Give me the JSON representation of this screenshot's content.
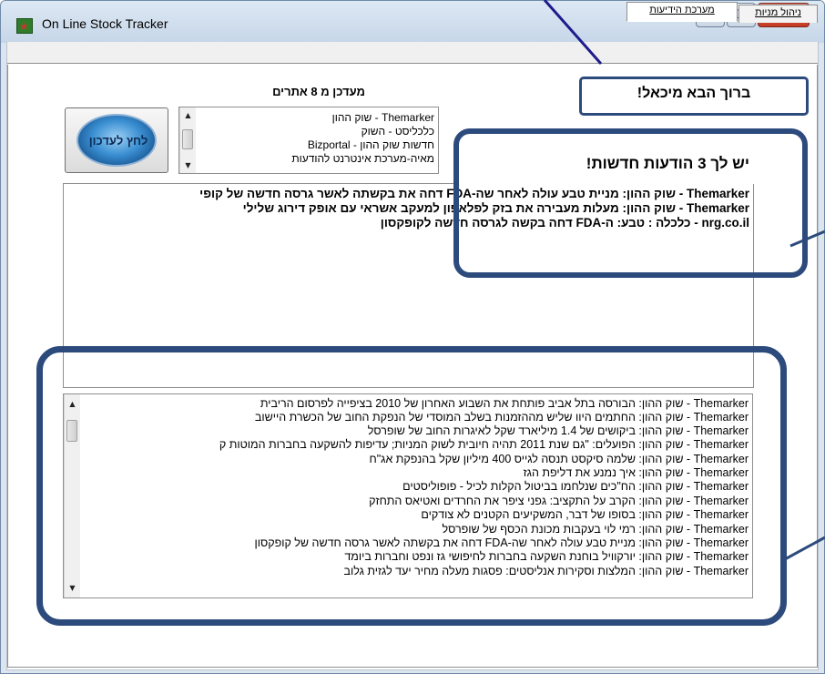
{
  "window": {
    "title": "On Line Stock Tracker",
    "controls": {
      "minimize": "—",
      "maximize": "☐",
      "close": "✕"
    }
  },
  "tabs": [
    {
      "label": "ניהול מניות",
      "selected": false
    },
    {
      "label": "מערכת הידיעות",
      "selected": true
    }
  ],
  "welcome_banner": "ברוך הבא מיכאל!",
  "new_messages_banner": "יש לך 3 הודעות חדשות!",
  "updated_title": "מעדכן מ 8 אתרים",
  "refresh_button": {
    "label": "לחץ לעדכון",
    "icon": "refresh-globe-icon"
  },
  "sources": [
    "Themarker - שוק ההון",
    "כלכליסט - השוק",
    "חדשות שוק ההון - Bizportal",
    "מאיה-מערכת אינטרנט להודעות"
  ],
  "alerts": [
    "Themarker - שוק ההון: מניית טבע עולה לאחר שה-FDA דחה את בקשתה לאשר גרסה חדשה של קופי",
    "Themarker - שוק ההון: מעלות מעבירה את בזק לפלאפון למעקב אשראי עם אופק דירוג שלילי",
    "nrg.co.il - כלכלה : טבע: ה-FDA דחה בקשה לגרסה חדשה לקופקסון"
  ],
  "headlines": [
    "Themarker - שוק ההון: הבורסה בתל אביב פותחת את השבוע האחרון של 2010 בציפייה לפרסום הריבית",
    "Themarker - שוק ההון: החתמים היוו שליש מההזמנות בשלב המוסדי של הנפקת החוב של הכשרת היישוב",
    "Themarker - שוק ההון: ביקושים של 1.4 מיליארד שקל לאיגרות החוב של שופרסל",
    "Themarker - שוק ההון: הפועלים: \"גם שנת 2011 תהיה חיובית לשוק המניות; עדיפות להשקעה בחברות המוטות ק",
    "Themarker - שוק ההון: שלמה סיקסט תנסה לגייס 400 מיליון שקל בהנפקת אג\"ח",
    "Themarker - שוק ההון: איך נמנע את דליפת הגז",
    "Themarker - שוק ההון: הח\"כים שנלחמו בביטול הקלות לכיל - פופוליסטים",
    "Themarker - שוק ההון: הקרב על התקציב: גפני ציפר את החרדים ואטיאס התחזק",
    "Themarker - שוק ההון: בסופו של דבר, המשקיעים הקטנים לא צודקים",
    "Themarker - שוק ההון: רמי לוי בעקבות מכונת הכסף של שופרסל",
    "Themarker - שוק ההון: מניית טבע עולה לאחר שה-FDA דחה את בקשתה לאשר גרסה חדשה של קופקסון",
    "Themarker - שוק ההון: יורקוויל בוחנת השקעה בחברות לחיפושי גז ונפט וחברות ביומד",
    "Themarker - שוק ההון: המלצות וסקירות אנליסטים: פסגות מעלה מחיר יעד לגזית גלוב"
  ],
  "colors": {
    "callout_border": "#2c4b7c",
    "title_bar": "#c6d6e8"
  }
}
